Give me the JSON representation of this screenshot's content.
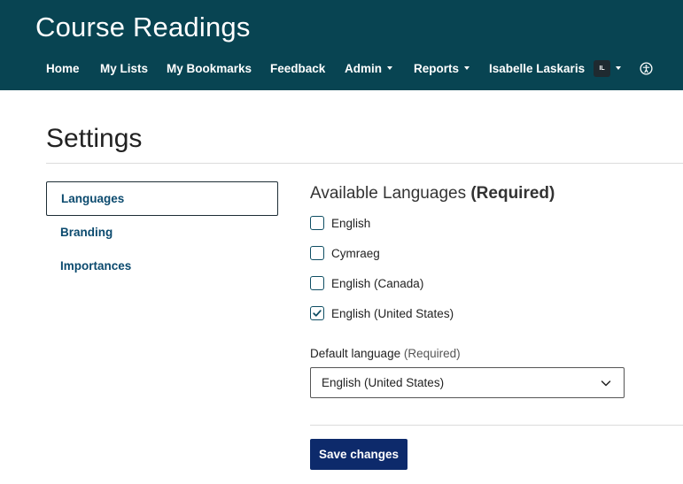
{
  "header": {
    "title": "Course Readings",
    "background_color": "#084452",
    "nav": {
      "home": "Home",
      "my_lists": "My Lists",
      "my_bookmarks": "My Bookmarks",
      "feedback": "Feedback",
      "admin": "Admin",
      "reports": "Reports",
      "user_name": "Isabelle Laskaris",
      "user_initials": "IL"
    },
    "accessibility_icon": "accessibility-icon"
  },
  "page": {
    "title": "Settings"
  },
  "sidebar": {
    "items": [
      {
        "label": "Languages",
        "active": true
      },
      {
        "label": "Branding",
        "active": false
      },
      {
        "label": "Importances",
        "active": false
      }
    ]
  },
  "languages": {
    "heading": "Available Languages",
    "heading_required": "(Required)",
    "options": [
      {
        "label": "English",
        "checked": false
      },
      {
        "label": "Cymraeg",
        "checked": false
      },
      {
        "label": "English (Canada)",
        "checked": false
      },
      {
        "label": "English (United States)",
        "checked": true
      }
    ],
    "default_label": "Default language",
    "default_required": "(Required)",
    "default_value": "English (United States)"
  },
  "actions": {
    "save_label": "Save changes",
    "save_color": "#0d2a6b"
  }
}
